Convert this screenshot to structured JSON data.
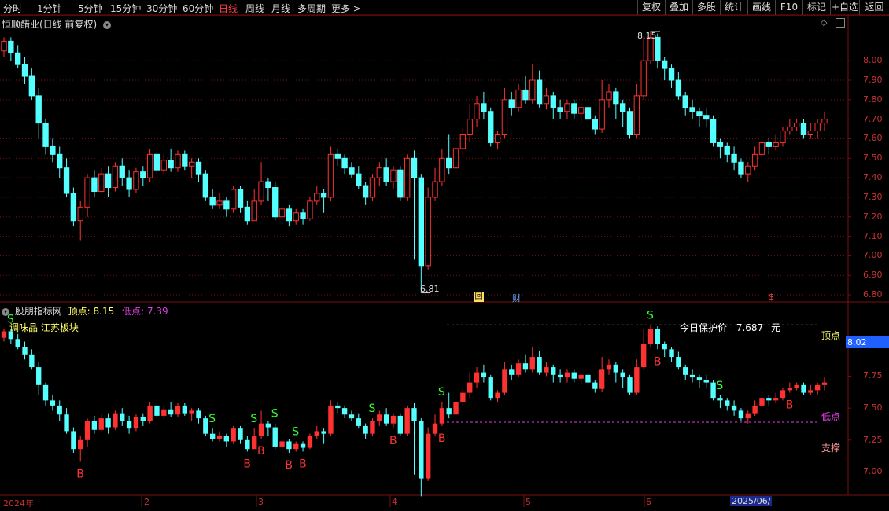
{
  "toolbar": {
    "periods": [
      "分时",
      "1分钟",
      "5分钟",
      "15分钟",
      "30分钟",
      "60分钟",
      "日线",
      "周线",
      "月线",
      "多周期",
      "更多 >"
    ],
    "active_period": "日线",
    "tools": [
      "复权",
      "叠加",
      "多股",
      "统计",
      "画线",
      "F10",
      "标记",
      "+自选",
      "返回"
    ]
  },
  "main_panel": {
    "title": "恒顺醋业(日线 前复权)",
    "high_label": "8.15",
    "low_label": "6.81",
    "marker_hui": "回",
    "marker_cai": "财",
    "marker_dollar": "$",
    "yticks": [
      "8.00",
      "7.90",
      "7.80",
      "7.70",
      "7.60",
      "7.50",
      "7.40",
      "7.30",
      "7.20",
      "7.10",
      "7.00",
      "6.90",
      "6.80"
    ]
  },
  "indicator_panel": {
    "name": "股朋指标网",
    "top_label": "顶点:",
    "top_value": "8.15",
    "low_label": "低点:",
    "low_value": "7.39",
    "sector": "调味品 江苏板块",
    "protect_label": "今日保护价",
    "protect_value": "7.687",
    "protect_unit": "元",
    "line_top": "顶点",
    "line_low": "低点",
    "support": "支撑",
    "current_price": "8.02",
    "yticks": [
      "8.00",
      "7.75",
      "7.50",
      "7.25",
      "7.00"
    ],
    "s_label": "S",
    "b_label": "B"
  },
  "date_axis": {
    "labels": [
      "2024年",
      "2",
      "3",
      "4",
      "5",
      "6"
    ],
    "highlight": "2025/06/"
  },
  "colors": {
    "up": "#ff3232",
    "down": "#54ffff",
    "grid": "#7a1010",
    "top_line": "#ffff66",
    "low_line": "#e040e0"
  },
  "chart_data": {
    "type": "candlestick",
    "y_range": [
      6.78,
      8.22
    ],
    "high": 8.15,
    "low": 6.81,
    "candles": [
      [
        8.05,
        8.1,
        8.12,
        8.02
      ],
      [
        8.1,
        8.04,
        8.12,
        8.0
      ],
      [
        8.04,
        7.98,
        8.08,
        7.96
      ],
      [
        7.98,
        7.92,
        8.02,
        7.88
      ],
      [
        7.92,
        7.82,
        7.96,
        7.8
      ],
      [
        7.82,
        7.68,
        7.86,
        7.6
      ],
      [
        7.68,
        7.56,
        7.7,
        7.52
      ],
      [
        7.56,
        7.52,
        7.6,
        7.48
      ],
      [
        7.52,
        7.45,
        7.56,
        7.4
      ],
      [
        7.45,
        7.32,
        7.5,
        7.3
      ],
      [
        7.32,
        7.18,
        7.35,
        7.15
      ],
      [
        7.18,
        7.25,
        7.28,
        7.08
      ],
      [
        7.25,
        7.4,
        7.42,
        7.2
      ],
      [
        7.4,
        7.33,
        7.44,
        7.3
      ],
      [
        7.33,
        7.42,
        7.45,
        7.32
      ],
      [
        7.42,
        7.35,
        7.46,
        7.3
      ],
      [
        7.35,
        7.46,
        7.48,
        7.33
      ],
      [
        7.46,
        7.4,
        7.5,
        7.36
      ],
      [
        7.4,
        7.34,
        7.44,
        7.3
      ],
      [
        7.34,
        7.43,
        7.45,
        7.32
      ],
      [
        7.43,
        7.4,
        7.46,
        7.36
      ],
      [
        7.4,
        7.52,
        7.55,
        7.38
      ],
      [
        7.52,
        7.44,
        7.54,
        7.42
      ],
      [
        7.44,
        7.49,
        7.52,
        7.42
      ],
      [
        7.49,
        7.45,
        7.55,
        7.43
      ],
      [
        7.45,
        7.52,
        7.54,
        7.43
      ],
      [
        7.52,
        7.46,
        7.54,
        7.44
      ],
      [
        7.46,
        7.48,
        7.5,
        7.4
      ],
      [
        7.48,
        7.42,
        7.5,
        7.38
      ],
      [
        7.42,
        7.3,
        7.44,
        7.28
      ],
      [
        7.3,
        7.26,
        7.34,
        7.24
      ],
      [
        7.26,
        7.28,
        7.32,
        7.24
      ],
      [
        7.28,
        7.24,
        7.3,
        7.2
      ],
      [
        7.24,
        7.34,
        7.36,
        7.22
      ],
      [
        7.34,
        7.25,
        7.36,
        7.22
      ],
      [
        7.25,
        7.18,
        7.28,
        7.16
      ],
      [
        7.18,
        7.28,
        7.34,
        7.18
      ],
      [
        7.28,
        7.38,
        7.48,
        7.26
      ],
      [
        7.38,
        7.35,
        7.4,
        7.28
      ],
      [
        7.35,
        7.2,
        7.38,
        7.18
      ],
      [
        7.2,
        7.24,
        7.26,
        7.16
      ],
      [
        7.24,
        7.18,
        7.26,
        7.15
      ],
      [
        7.18,
        7.22,
        7.24,
        7.16
      ],
      [
        7.22,
        7.19,
        7.24,
        7.16
      ],
      [
        7.19,
        7.28,
        7.3,
        7.18
      ],
      [
        7.28,
        7.32,
        7.36,
        7.26
      ],
      [
        7.32,
        7.3,
        7.34,
        7.22
      ],
      [
        7.3,
        7.52,
        7.56,
        7.28
      ],
      [
        7.52,
        7.5,
        7.55,
        7.46
      ],
      [
        7.5,
        7.45,
        7.52,
        7.42
      ],
      [
        7.45,
        7.42,
        7.48,
        7.4
      ],
      [
        7.42,
        7.36,
        7.46,
        7.34
      ],
      [
        7.36,
        7.3,
        7.38,
        7.26
      ],
      [
        7.3,
        7.4,
        7.42,
        7.28
      ],
      [
        7.4,
        7.45,
        7.48,
        7.36
      ],
      [
        7.45,
        7.38,
        7.5,
        7.36
      ],
      [
        7.38,
        7.44,
        7.46,
        7.34
      ],
      [
        7.44,
        7.3,
        7.46,
        7.28
      ],
      [
        7.3,
        7.5,
        7.52,
        7.28
      ],
      [
        7.5,
        7.4,
        7.54,
        6.98
      ],
      [
        7.4,
        6.95,
        7.42,
        6.81
      ],
      [
        6.95,
        7.3,
        7.35,
        6.93
      ],
      [
        7.3,
        7.38,
        7.45,
        7.28
      ],
      [
        7.38,
        7.5,
        7.55,
        7.36
      ],
      [
        7.5,
        7.45,
        7.62,
        7.42
      ],
      [
        7.45,
        7.55,
        7.6,
        7.43
      ],
      [
        7.55,
        7.62,
        7.66,
        7.52
      ],
      [
        7.62,
        7.7,
        7.78,
        7.58
      ],
      [
        7.7,
        7.78,
        7.82,
        7.66
      ],
      [
        7.78,
        7.74,
        7.84,
        7.7
      ],
      [
        7.74,
        7.58,
        7.76,
        7.56
      ],
      [
        7.58,
        7.62,
        7.64,
        7.55
      ],
      [
        7.62,
        7.8,
        7.86,
        7.6
      ],
      [
        7.8,
        7.76,
        7.84,
        7.72
      ],
      [
        7.76,
        7.85,
        7.88,
        7.74
      ],
      [
        7.85,
        7.8,
        7.92,
        7.78
      ],
      [
        7.8,
        7.9,
        7.98,
        7.78
      ],
      [
        7.9,
        7.78,
        7.95,
        7.76
      ],
      [
        7.78,
        7.82,
        7.86,
        7.75
      ],
      [
        7.82,
        7.76,
        7.84,
        7.7
      ],
      [
        7.76,
        7.74,
        7.8,
        7.7
      ],
      [
        7.74,
        7.78,
        7.8,
        7.7
      ],
      [
        7.78,
        7.73,
        7.8,
        7.7
      ],
      [
        7.73,
        7.76,
        7.78,
        7.68
      ],
      [
        7.76,
        7.7,
        7.78,
        7.66
      ],
      [
        7.7,
        7.65,
        7.72,
        7.62
      ],
      [
        7.65,
        7.8,
        7.9,
        7.63
      ],
      [
        7.8,
        7.84,
        7.88,
        7.76
      ],
      [
        7.84,
        7.78,
        7.86,
        7.7
      ],
      [
        7.78,
        7.74,
        7.8,
        7.66
      ],
      [
        7.74,
        7.62,
        7.76,
        7.6
      ],
      [
        7.62,
        7.82,
        7.88,
        7.6
      ],
      [
        7.82,
        8.0,
        8.12,
        7.8
      ],
      [
        8.0,
        8.12,
        8.15,
        7.98
      ],
      [
        8.12,
        8.0,
        8.14,
        7.96
      ],
      [
        8.0,
        7.96,
        8.02,
        7.9
      ],
      [
        7.96,
        7.9,
        7.98,
        7.86
      ],
      [
        7.9,
        7.82,
        7.94,
        7.8
      ],
      [
        7.82,
        7.76,
        7.84,
        7.72
      ],
      [
        7.76,
        7.74,
        7.8,
        7.7
      ],
      [
        7.74,
        7.72,
        7.76,
        7.66
      ],
      [
        7.72,
        7.7,
        7.76,
        7.66
      ],
      [
        7.7,
        7.58,
        7.72,
        7.56
      ],
      [
        7.58,
        7.56,
        7.6,
        7.5
      ],
      [
        7.56,
        7.52,
        7.58,
        7.48
      ],
      [
        7.52,
        7.48,
        7.56,
        7.44
      ],
      [
        7.48,
        7.42,
        7.5,
        7.4
      ],
      [
        7.42,
        7.46,
        7.48,
        7.38
      ],
      [
        7.46,
        7.52,
        7.56,
        7.44
      ],
      [
        7.52,
        7.58,
        7.6,
        7.48
      ],
      [
        7.58,
        7.56,
        7.6,
        7.52
      ],
      [
        7.56,
        7.58,
        7.62,
        7.54
      ],
      [
        7.58,
        7.64,
        7.66,
        7.56
      ],
      [
        7.64,
        7.66,
        7.7,
        7.62
      ],
      [
        7.66,
        7.68,
        7.7,
        7.64
      ],
      [
        7.68,
        7.62,
        7.7,
        7.6
      ],
      [
        7.62,
        7.64,
        7.68,
        7.6
      ],
      [
        7.64,
        7.68,
        7.7,
        7.6
      ],
      [
        7.68,
        7.7,
        7.74,
        7.64
      ]
    ],
    "signals": [
      {
        "i": 1,
        "type": "S"
      },
      {
        "i": 11,
        "type": "B"
      },
      {
        "i": 30,
        "type": "S"
      },
      {
        "i": 35,
        "type": "B"
      },
      {
        "i": 36,
        "type": "S"
      },
      {
        "i": 37,
        "type": "B"
      },
      {
        "i": 39,
        "type": "S"
      },
      {
        "i": 41,
        "type": "B"
      },
      {
        "i": 42,
        "type": "S"
      },
      {
        "i": 43,
        "type": "B"
      },
      {
        "i": 53,
        "type": "S"
      },
      {
        "i": 56,
        "type": "B"
      },
      {
        "i": 63,
        "type": "S"
      },
      {
        "i": 63,
        "type": "B"
      },
      {
        "i": 93,
        "type": "S"
      },
      {
        "i": 94,
        "type": "B"
      },
      {
        "i": 103,
        "type": "S"
      },
      {
        "i": 113,
        "type": "B"
      }
    ]
  }
}
